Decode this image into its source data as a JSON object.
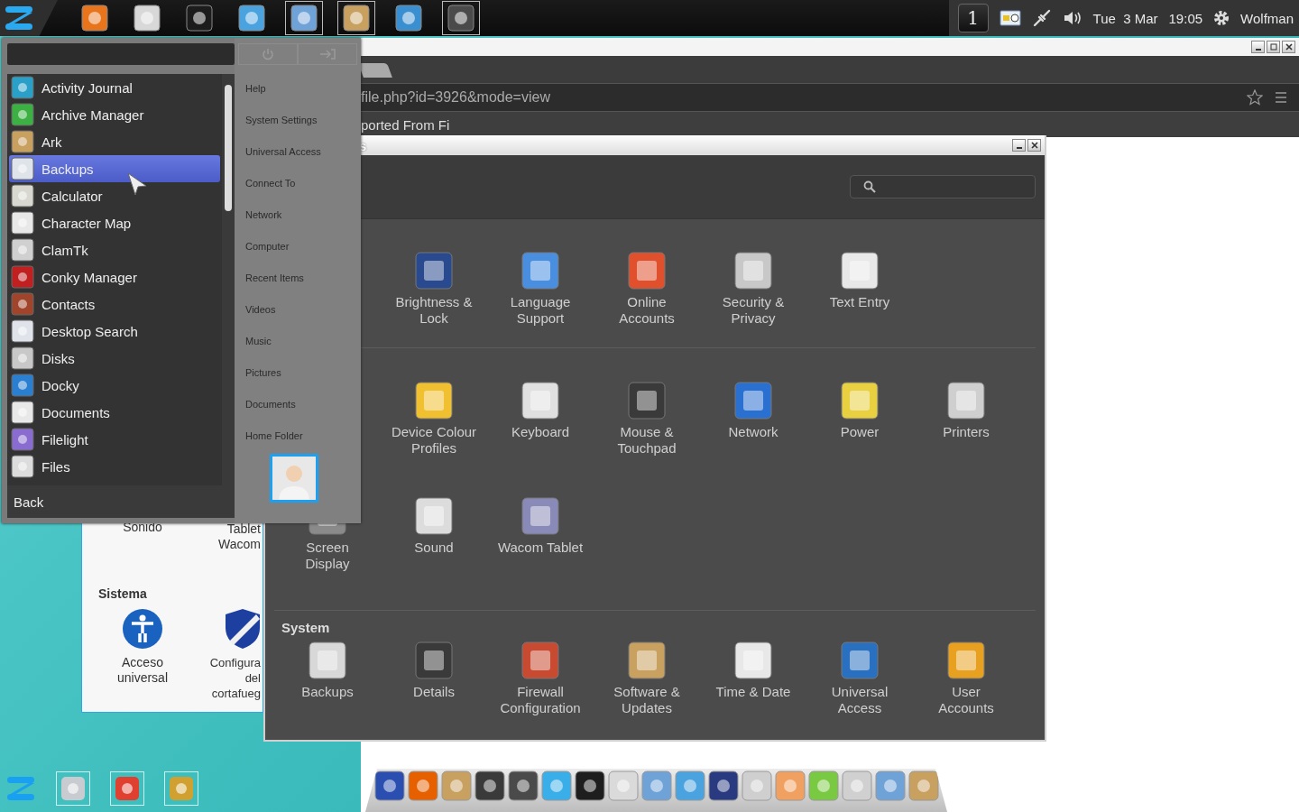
{
  "top_panel": {
    "launchers": [
      {
        "active": false
      },
      {
        "active": false
      },
      {
        "active": false
      },
      {
        "active": false
      },
      {
        "active": true
      },
      {
        "active": true
      },
      {
        "active": false
      },
      {
        "active": true
      }
    ],
    "workspace": "1",
    "date": "Tue  3 Mar",
    "time": "19:05",
    "user": "Wolfman"
  },
  "browser": {
    "url": "file.php?id=3926&mode=view",
    "bookmark": "ported From Fi"
  },
  "background_window": {
    "items": [
      {
        "label": "Sonido"
      },
      {
        "label": "Tablet\nWacom"
      }
    ],
    "section": "Sistema",
    "system_items": [
      {
        "label": "Acceso\nuniversal"
      },
      {
        "label": "Configura\ndel\ncortafueg"
      }
    ]
  },
  "settings_window": {
    "title": "s",
    "sections": [
      {
        "items": [
          {
            "label": "Brightness &\nLock"
          },
          {
            "label": "Language\nSupport"
          },
          {
            "label": "Online\nAccounts"
          },
          {
            "label": "Security &\nPrivacy"
          },
          {
            "label": "Text Entry"
          }
        ]
      },
      {
        "items": [
          {
            "label": "Device Colour\nProfiles"
          },
          {
            "label": "Keyboard"
          },
          {
            "label": "Mouse &\nTouchpad"
          },
          {
            "label": "Network"
          },
          {
            "label": "Power"
          },
          {
            "label": "Printers"
          },
          {
            "label": "Screen\nDisplay"
          },
          {
            "label": "Sound"
          },
          {
            "label": "Wacom Tablet"
          }
        ]
      },
      {
        "heading": "System",
        "items": [
          {
            "label": "Backups"
          },
          {
            "label": "Details"
          },
          {
            "label": "Firewall\nConfiguration"
          },
          {
            "label": "Software &\nUpdates"
          },
          {
            "label": "Time & Date"
          },
          {
            "label": "Universal\nAccess"
          },
          {
            "label": "User\nAccounts"
          }
        ]
      }
    ]
  },
  "menu": {
    "apps": [
      {
        "label": "Activity Journal",
        "selected": false
      },
      {
        "label": "Archive Manager",
        "selected": false
      },
      {
        "label": "Ark",
        "selected": false
      },
      {
        "label": "Backups",
        "selected": true
      },
      {
        "label": "Calculator",
        "selected": false
      },
      {
        "label": "Character Map",
        "selected": false
      },
      {
        "label": "ClamTk",
        "selected": false
      },
      {
        "label": "Conky Manager",
        "selected": false
      },
      {
        "label": "Contacts",
        "selected": false
      },
      {
        "label": "Desktop Search",
        "selected": false
      },
      {
        "label": "Disks",
        "selected": false
      },
      {
        "label": "Docky",
        "selected": false
      },
      {
        "label": "Documents",
        "selected": false
      },
      {
        "label": "Filelight",
        "selected": false
      },
      {
        "label": "Files",
        "selected": false
      }
    ],
    "places": [
      "Help",
      "System Settings",
      "Universal Access",
      "Connect To",
      "Network",
      "Computer",
      "Recent Items",
      "Videos",
      "Music",
      "Pictures",
      "Documents",
      "Home Folder"
    ],
    "back": "Back"
  }
}
